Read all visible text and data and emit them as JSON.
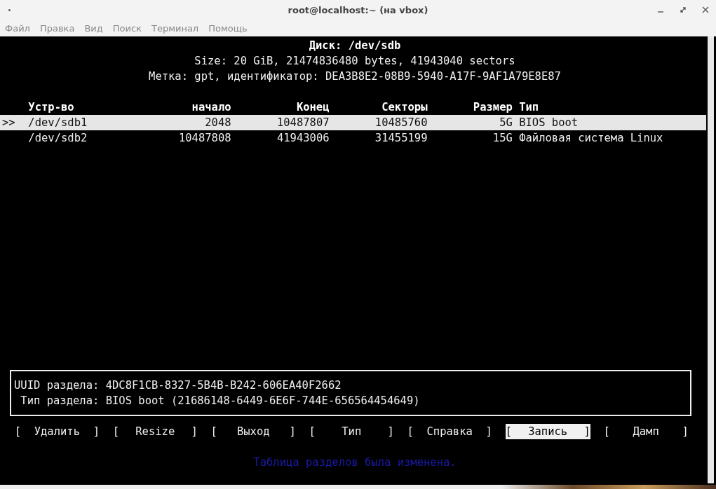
{
  "window": {
    "title": "root@localhost:~ (на vbox)"
  },
  "menu": [
    "Файл",
    "Правка",
    "Вид",
    "Поиск",
    "Терминал",
    "Помощь"
  ],
  "disk": {
    "title": "Диск: /dev/sdb",
    "size": "Size: 20 GiB, 21474836480 bytes, 41943040 sectors",
    "label": "Метка: gpt, идентификатор: DEA3B8E2-08B9-5940-A17F-9AF1A79E8E87"
  },
  "table": {
    "columns": [
      "Устр-во",
      "начало",
      "Конец",
      "Секторы",
      "Размер",
      "Тип"
    ],
    "rows": [
      {
        "cursor": ">>",
        "selected": true,
        "cells": [
          "/dev/sdb1",
          "2048",
          "10487807",
          "10485760",
          "5G",
          "BIOS boot"
        ]
      },
      {
        "selected": false,
        "cells": [
          "/dev/sdb2",
          "10487808",
          "41943006",
          "31455199",
          "15G",
          "Файловая система Linux"
        ]
      }
    ]
  },
  "info": [
    "UUID раздела: 4DC8F1CB-8327-5B4B-B242-606EA40F2662",
    " Тип раздела: BIOS boot (21686148-6449-6E6F-744E-656564454649)"
  ],
  "buttons": [
    {
      "left": "[",
      "label": "Удалить",
      "right": "]",
      "selected": false
    },
    {
      "left": "[",
      "label": "Resize",
      "right": "]",
      "selected": false
    },
    {
      "left": "[",
      "label": "Выход",
      "right": "]",
      "selected": false
    },
    {
      "left": "[",
      "label": "Тип",
      "right": "]",
      "selected": false
    },
    {
      "left": "[",
      "label": "Справка",
      "right": "]",
      "selected": false
    },
    {
      "left": "[",
      "label": "Запись",
      "right": "]",
      "selected": true
    },
    {
      "left": "[",
      "label": "Дамп",
      "right": "]",
      "selected": false
    }
  ],
  "status": "Таблица разделов была изменена."
}
